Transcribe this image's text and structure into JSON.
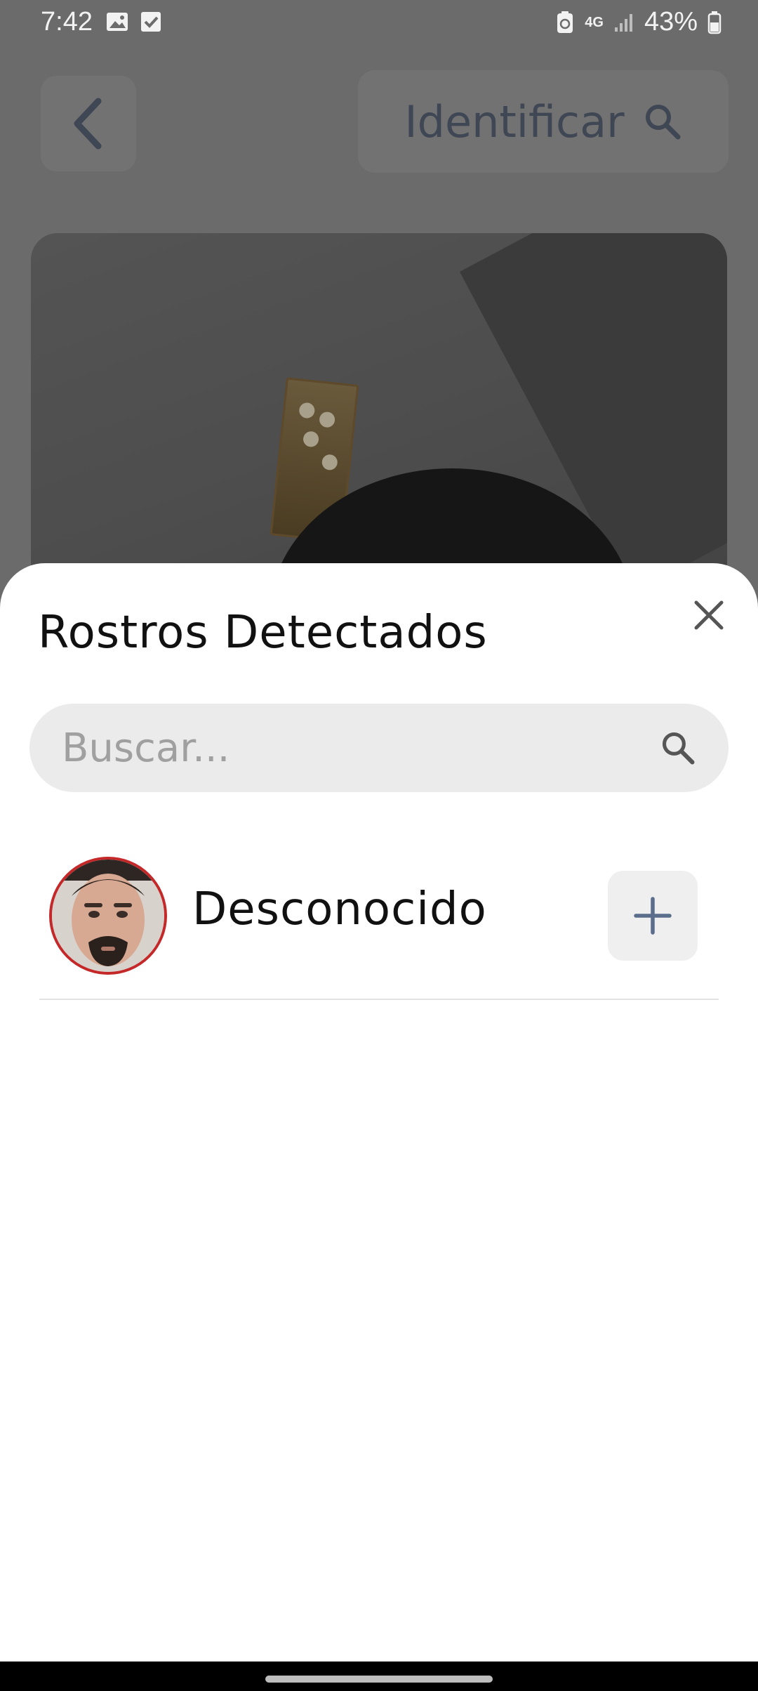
{
  "status_bar": {
    "time": "7:42",
    "network": "4G",
    "battery": "43%",
    "icons": [
      "gallery-icon",
      "checkbox-icon",
      "battery-saver-icon",
      "network-4g-icon",
      "signal-icon",
      "battery-icon"
    ]
  },
  "header": {
    "back_icon": "chevron-left-icon",
    "identify_label": "Identificar",
    "identify_icon": "search-icon"
  },
  "sheet": {
    "title": "Rostros Detectados",
    "close_icon": "close-icon",
    "search": {
      "placeholder": "Buscar...",
      "value": "",
      "icon": "search-icon"
    },
    "faces": [
      {
        "name": "Desconocido",
        "action_icon": "plus-icon"
      }
    ]
  },
  "colors": {
    "overlay": "#6b6b6b",
    "sheet_background": "#ffffff",
    "avatar_ring": "#c42828",
    "accent_icon": "#5a6e8c",
    "search_background": "#ebebeb"
  }
}
